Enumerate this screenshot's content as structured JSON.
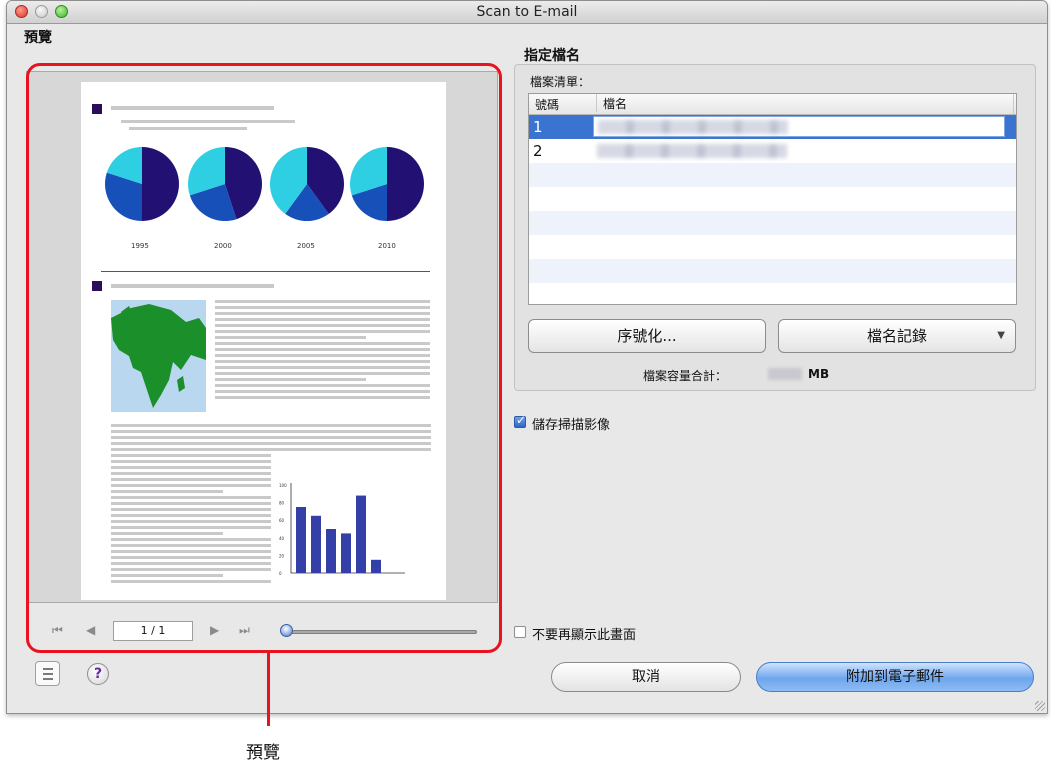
{
  "window": {
    "title": "Scan to E-mail"
  },
  "preview": {
    "section_label": "預覽",
    "page_indicator": "1 / 1",
    "document": {
      "pie_years": [
        "1995",
        "2000",
        "2005",
        "2010"
      ],
      "bar_axis_ticks": [
        "100",
        "80",
        "60",
        "40",
        "20",
        "0"
      ],
      "bar_values": [
        75,
        65,
        50,
        45,
        88,
        15
      ],
      "colors": {
        "pie_light": "#2ecfe3",
        "pie_mid": "#1650b8",
        "pie_dark": "#221072",
        "bar": "#3440a8",
        "map": "#1a8f2a"
      }
    },
    "callout_label": "預覽"
  },
  "filename": {
    "section_label": "指定檔名",
    "list_caption": "檔案清單：",
    "columns": [
      "號碼",
      "檔名"
    ],
    "rows": [
      {
        "number": "1",
        "selected": true
      },
      {
        "number": "2",
        "selected": false
      }
    ],
    "serialize_button": "序號化...",
    "history_button": "檔名記錄",
    "total_label": "檔案容量合計：",
    "total_unit": "MB"
  },
  "save_checkbox": {
    "label": "儲存掃描影像",
    "checked": true
  },
  "dont_show_checkbox": {
    "label": "不要再顯示此畫面",
    "checked": false
  },
  "buttons": {
    "cancel": "取消",
    "attach": "附加到電子郵件"
  },
  "icons": {
    "first": "⏮",
    "prev": "◀",
    "next": "▶",
    "last": "⏭",
    "help": "?"
  },
  "colors": {
    "accent_red": "#e8131f",
    "selection_blue": "#3a74d0"
  }
}
